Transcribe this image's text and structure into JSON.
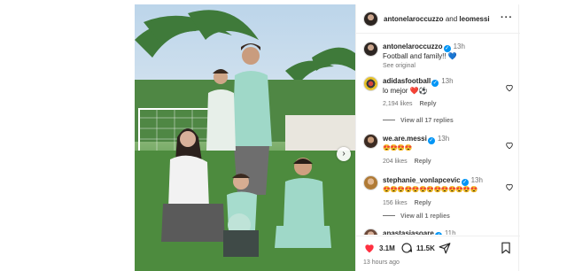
{
  "post": {
    "header_user": "antonelaroccuzzo",
    "header_and": "and",
    "header_coauthor": "leomessi",
    "more_icon": "more-horizontal-icon"
  },
  "caption": {
    "user": "antonelaroccuzzo",
    "time": "13h",
    "text": "Football and family!! 💙",
    "see_original": "See original"
  },
  "comments": [
    {
      "user": "adidasfootball",
      "time": "13h",
      "text": "lo mejor ❤️⚽",
      "likes": "2,194 likes",
      "reply": "Reply",
      "view_replies": "View all 17 replies"
    },
    {
      "user": "we.are.messi",
      "time": "13h",
      "text": "😍😍😍😍",
      "likes": "204 likes",
      "reply": "Reply"
    },
    {
      "user": "stephanie_vonlapcevic",
      "time": "13h",
      "text": "😍😍😍😍😍😍😍😍😍😍😍😍😍",
      "likes": "156 likes",
      "reply": "Reply",
      "view_replies": "View all 1 replies"
    },
    {
      "user": "anastasiasoare",
      "time": "11h"
    }
  ],
  "actions": {
    "likes_count": "3.1M",
    "comments_count": "11.5K",
    "time_ago": "13 hours ago"
  },
  "colors": {
    "like_red": "#ff3040",
    "verified_blue": "#0095f6"
  }
}
